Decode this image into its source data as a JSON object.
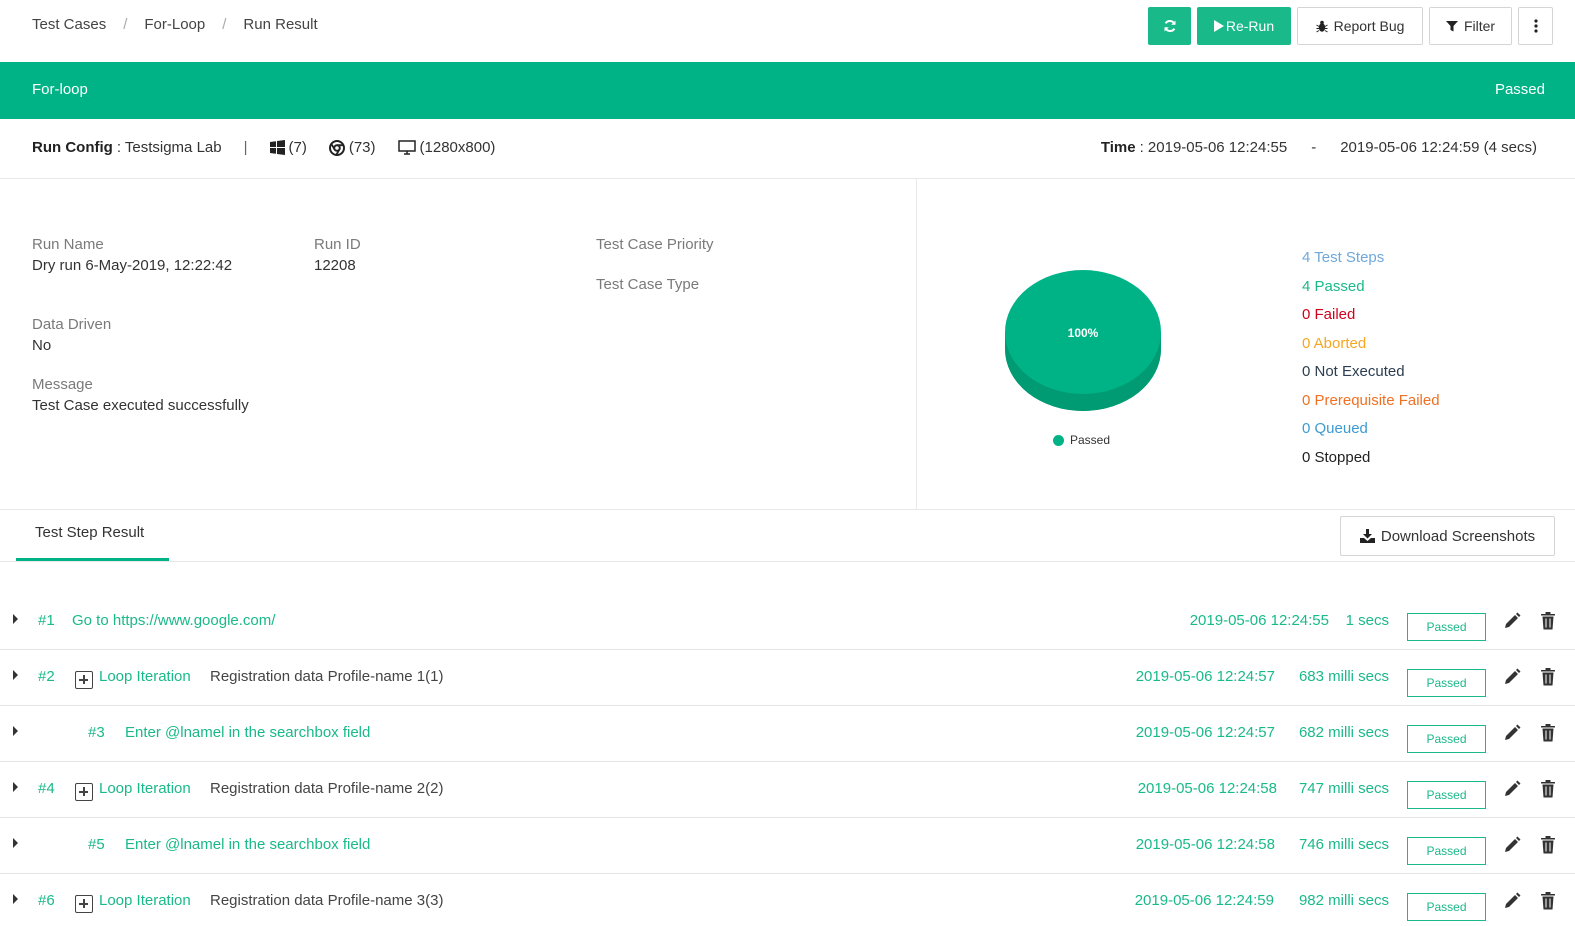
{
  "breadcrumb": [
    "Test Cases",
    "For-Loop",
    "Run Result"
  ],
  "toolbar": {
    "refresh_icon": "refresh-icon",
    "rerun_label": "Re-Run",
    "report_bug_label": "Report Bug",
    "filter_label": "Filter",
    "more_icon": "vertical-ellipsis-icon"
  },
  "banner": {
    "title": "For-loop",
    "status": "Passed"
  },
  "run_config": {
    "label": "Run Config",
    "value": ": Testsigma Lab",
    "separator": "|",
    "os": "(7)",
    "browser": "(73)",
    "resolution": "(1280x800)",
    "time_label": "Time",
    "time_start": ": 2019-05-06 12:24:55",
    "time_sep": "-",
    "time_end": "2019-05-06 12:24:59 (4 secs)"
  },
  "details": {
    "run_name_label": "Run Name",
    "run_name": "Dry run 6-May-2019, 12:22:42",
    "run_id_label": "Run ID",
    "run_id": "12208",
    "priority_label": "Test Case Priority",
    "type_label": "Test Case Type",
    "data_driven_label": "Data Driven",
    "data_driven": "No",
    "message_label": "Message",
    "message": "Test Case executed successfully"
  },
  "summary": {
    "pie_label": "100%",
    "legend": "Passed",
    "colors": {
      "passed": "#00b386",
      "failed": "#d0021b",
      "aborted": "#f5a623",
      "not_executed": "#2c3e50",
      "prerequisite": "#f07023",
      "queued": "#3d9ad1",
      "steps": "#6fa8dc"
    },
    "counts": [
      {
        "text": "4 Test Steps",
        "color": "#6fa8dc"
      },
      {
        "text": "4 Passed",
        "color": "#1ab98a"
      },
      {
        "text": "0 Failed",
        "color": "#d0021b"
      },
      {
        "text": "0 Aborted",
        "color": "#f5a623"
      },
      {
        "text": "0 Not Executed",
        "color": "#2c3e50"
      },
      {
        "text": "0 Prerequisite Failed",
        "color": "#f07023"
      },
      {
        "text": "0 Queued",
        "color": "#3d9ad1"
      },
      {
        "text": "0 Stopped",
        "color": "#222222"
      }
    ]
  },
  "tabs": {
    "active": "Test Step Result",
    "download_label": "Download Screenshots"
  },
  "steps": [
    {
      "num": "#1",
      "text": "Go to https://www.google.com/",
      "timestamp": "2019-05-06 12:24:55",
      "duration": "1 secs",
      "status": "Passed"
    },
    {
      "num": "#2",
      "loop": "Loop Iteration",
      "text": "Registration data Profile-name 1(1)",
      "timestamp": "2019-05-06 12:24:57",
      "duration": "683 milli secs",
      "status": "Passed"
    },
    {
      "num": "#3",
      "text": "Enter @lnamel in the searchbox field",
      "timestamp": "2019-05-06 12:24:57",
      "duration": "682 milli secs",
      "status": "Passed"
    },
    {
      "num": "#4",
      "loop": "Loop Iteration",
      "text": "Registration data Profile-name 2(2)",
      "timestamp": "2019-05-06 12:24:58",
      "duration": "747 milli secs",
      "status": "Passed"
    },
    {
      "num": "#5",
      "text": "Enter @lnamel in the searchbox field",
      "timestamp": "2019-05-06 12:24:58",
      "duration": "746 milli secs",
      "status": "Passed"
    },
    {
      "num": "#6",
      "loop": "Loop Iteration",
      "text": "Registration data Profile-name 3(3)",
      "timestamp": "2019-05-06 12:24:59",
      "duration": "982 milli secs",
      "status": "Passed"
    }
  ]
}
